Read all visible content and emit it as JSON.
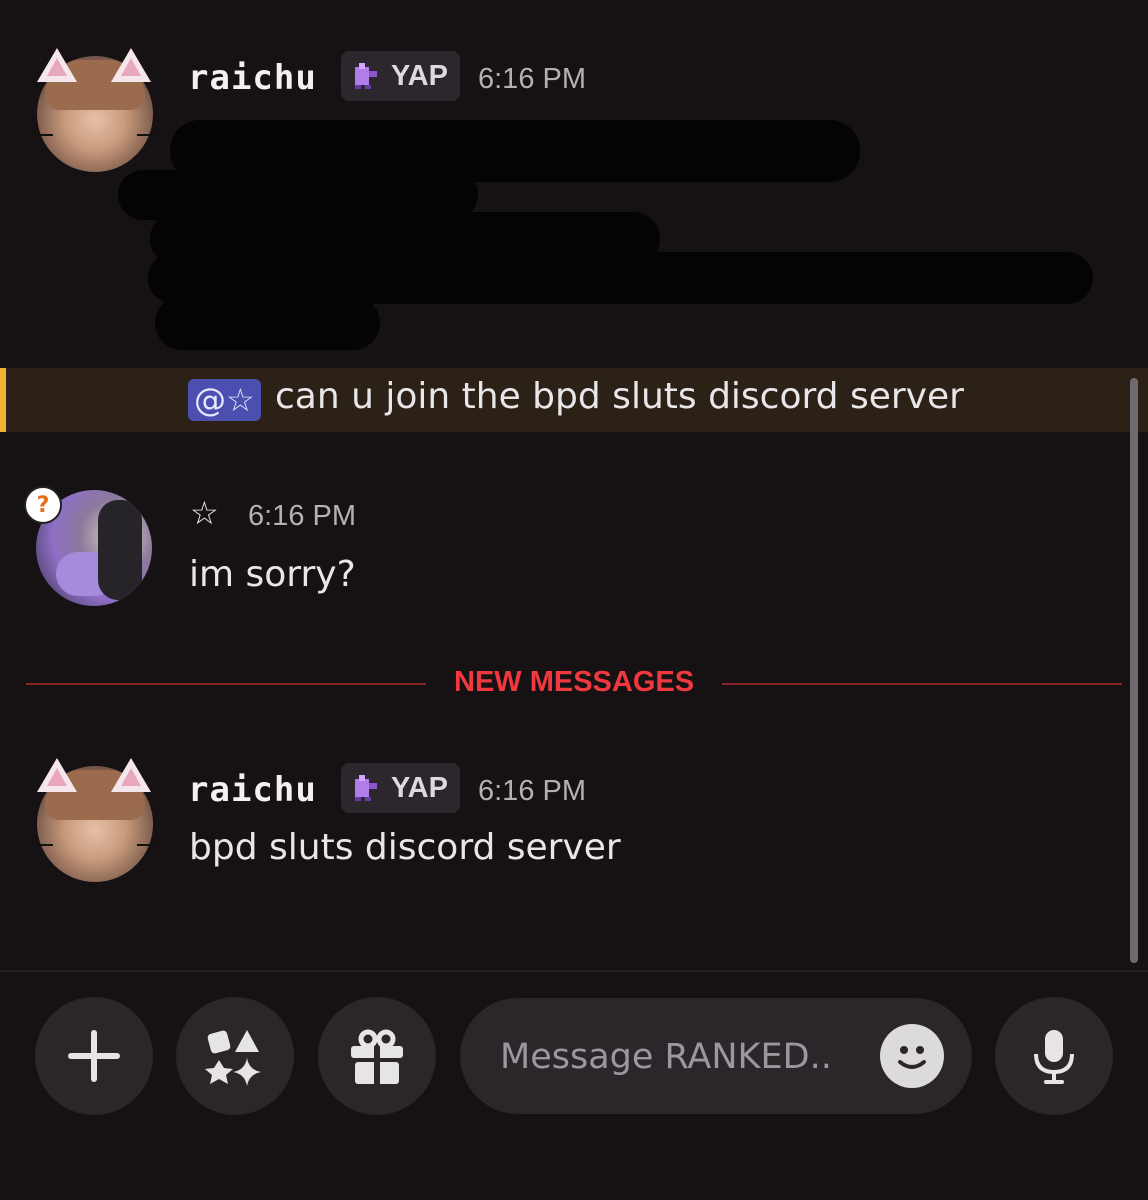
{
  "messages": [
    {
      "username": "raichu",
      "tag": "YAP",
      "time": "6:16 PM",
      "mention": "@☆",
      "mention_text": "can u join the bpd sluts discord server"
    },
    {
      "username": "☆",
      "time": "6:16 PM",
      "text": "im sorry?"
    },
    {
      "username": "raichu",
      "tag": "YAP",
      "time": "6:16 PM",
      "text": "bpd sluts discord server"
    }
  ],
  "new_messages_label": "NEW MESSAGES",
  "composer": {
    "placeholder": "Message RANKED.."
  },
  "colors": {
    "background": "#161113",
    "mention_highlight": "#2b2117",
    "mention_bar": "#f0b232",
    "new_messages": "#f0393e"
  },
  "icons": [
    "plus-icon",
    "apps-icon",
    "gift-icon",
    "emoji-icon",
    "microphone-icon",
    "badge-icon",
    "question-icon"
  ]
}
